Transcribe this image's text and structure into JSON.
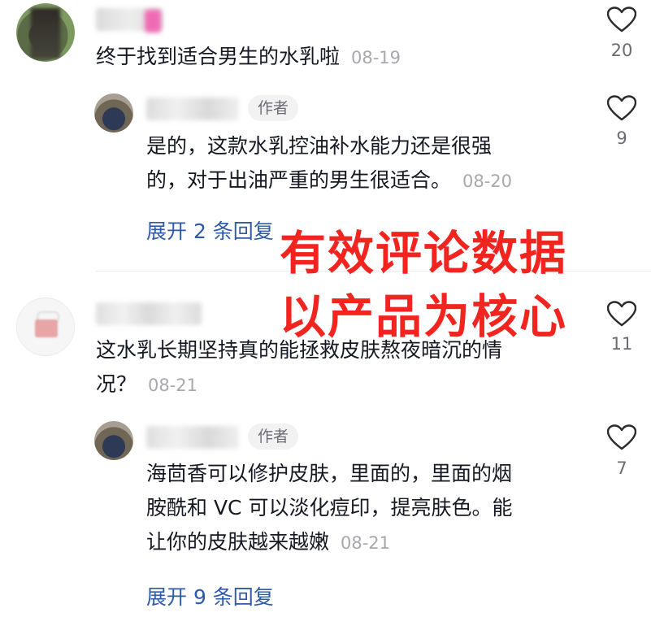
{
  "comments": [
    {
      "text": "终于找到适合男生的水乳啦",
      "date": "08-19",
      "likes": "20"
    },
    {
      "author_badge": "作者",
      "text_lines": [
        "是的，这款水乳控油补水能力还是很强",
        "的，对于出油严重的男生很适合。"
      ],
      "date": "08-20",
      "likes": "9",
      "expand": "展开 2 条回复"
    },
    {
      "text_lines": [
        "这水乳长期坚持真的能拯救皮肤熬夜暗沉的情",
        "况？"
      ],
      "date": "08-21",
      "likes": "11"
    },
    {
      "author_badge": "作者",
      "text_lines": [
        "海茴香可以修护皮肤，里面的，里面的烟",
        "胺酰和 VC 可以淡化痘印，提亮肤色。能",
        "让你的皮肤越来越嫩"
      ],
      "date": "08-21",
      "likes": "7",
      "expand": "展开 9 条回复"
    }
  ],
  "overlay": {
    "line1": "有效评论数据",
    "line2": "以产品为核心",
    "color": "#f22420"
  },
  "icons": {
    "like": "heart-outline-icon"
  }
}
